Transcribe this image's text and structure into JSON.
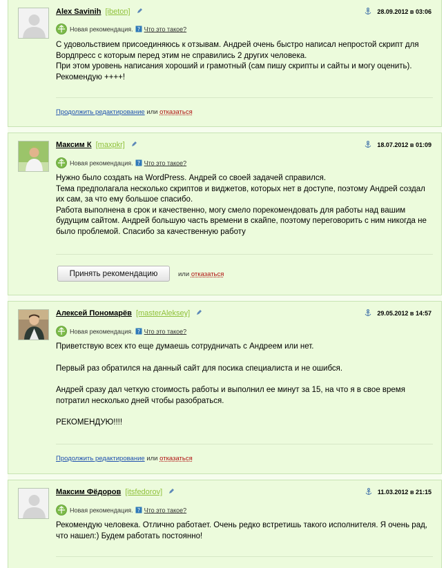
{
  "reviews": [
    {
      "name": "Alex Savinih",
      "login": "[ibeton]",
      "date": "28.09.2012 в 03:06",
      "rec_label": "Новая рекомендация.",
      "what_link": "Что это такое?",
      "avatar": "default-avatar",
      "body": [
        "С удовольствием присоединяюсь к отзывам. Андрей очень быстро написал непростой скрипт для Вордпресс с которым перед этим не справились 2 других человека.\nПри этом уровень написания хороший и грамотный (сам пишу скрипты и сайты и могу оценить). Рекомендую ++++!"
      ],
      "edit_link": "Продолжить редактирование",
      "or": "или",
      "cancel_link": "отказаться"
    },
    {
      "name": "Максим К",
      "login": "[maxpkr]",
      "date": "18.07.2012 в 01:09",
      "rec_label": "Новая рекомендация.",
      "what_link": "Что это такое?",
      "avatar": "photo-avatar",
      "body": [
        "Нужно было создать на WordPress. Андрей со своей задачей справился.\nТема предполагала несколько скриптов и виджетов, которых нет в доступе, поэтому Андрей создал их сам, за что ему большое спасибо.\nРабота выполнена в срок и качественно, могу смело порекомендовать для работы над вашим будущим сайтом. Андрей большую часть времени в скайпе, поэтому переговорить с ним никогда не было проблемой. Спасибо за качественную работу"
      ],
      "accept_button": "Принять рекомендацию",
      "or": "или",
      "cancel_link": "отказаться"
    },
    {
      "name": "Алексей Пономарёв",
      "login": "[masterAleksey]",
      "date": "29.05.2012 в 14:57",
      "rec_label": "Новая рекомендация.",
      "what_link": "Что это такое?",
      "avatar": "photo-avatar",
      "body": [
        "Приветствую всех кто еще думаешь сотрудничать с Андреем или нет.",
        "Первый раз обратился на данный сайт для посика специалиста и не ошибся.",
        "Андрей сразу дал четкую стоимость работы и выполнил ее минут за 15, на что я в свое время потратил несколько дней чтобы разобраться.",
        "РЕКОМЕНДУЮ!!!!"
      ],
      "edit_link": "Продолжить редактирование",
      "or": "или",
      "cancel_link": "отказаться"
    },
    {
      "name": "Максим Фёдоров",
      "login": "[itsfedorov]",
      "date": "11.03.2012 в 21:15",
      "rec_label": "Новая рекомендация.",
      "what_link": "Что это такое?",
      "avatar": "default-avatar",
      "body": [
        "Рекомендую человека. Отлично работает. Очень редко встретишь такого исполнителя. Я очень рад, что нашел:) Будем работать постоянно!"
      ]
    }
  ],
  "colors": {
    "card_bg": "#ecfbdc",
    "border": "#c7e3b3",
    "login": "#8fc03a",
    "link": "#1d4fae",
    "cancel": "#b01010",
    "badge": "#7dbb4a"
  },
  "icons": [
    "pen-icon",
    "anchor-icon",
    "recommendation-badge-icon",
    "question-icon"
  ]
}
